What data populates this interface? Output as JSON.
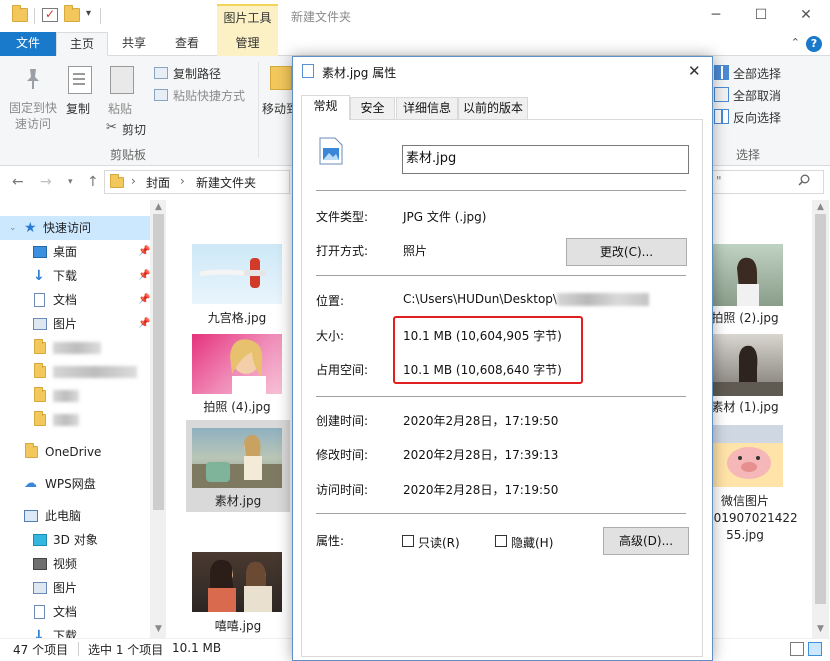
{
  "window": {
    "title": "新建文件夹",
    "context_tab_group": "图片工具"
  },
  "ribbon": {
    "tabs": [
      "文件",
      "主页",
      "共享",
      "查看",
      "管理"
    ],
    "pin_quick_access": [
      "固定到快",
      "速访问"
    ],
    "copy": "复制",
    "paste": "粘贴",
    "copy_path": "复制路径",
    "paste_shortcut": "粘贴快捷方式",
    "cut": "剪切",
    "clipboard_group": "剪贴板",
    "move_to": "移动到",
    "select_all": "全部选择",
    "select_none": "全部取消",
    "invert_selection": "反向选择",
    "select_group": "选择"
  },
  "address": {
    "crumbs": [
      "封面",
      "新建文件夹"
    ],
    "search_fragment": "\""
  },
  "nav": {
    "quick_access": "快速访问",
    "desktop": "桌面",
    "downloads": "下载",
    "documents": "文档",
    "pictures": "图片",
    "onedrive": "OneDrive",
    "wps": "WPS网盘",
    "this_pc": "此电脑",
    "objects3d": "3D 对象",
    "videos": "视频",
    "pictures2": "图片",
    "documents2": "文档",
    "downloads2": "下载"
  },
  "files": {
    "f1": "九宫格.jpg",
    "f2": "拍照 (4).jpg",
    "f3": "素材.jpg",
    "f4": "嘻嘻.jpg",
    "r1": "拍照 (2).jpg",
    "r2": "素材 (1).jpg",
    "r3": [
      "微信图片",
      "_201907021422",
      "55.jpg"
    ]
  },
  "status": {
    "count": "47 个项目",
    "selected": "选中 1 个项目",
    "size": "10.1 MB"
  },
  "dialog": {
    "title": "素材.jpg 属性",
    "tabs": [
      "常规",
      "安全",
      "详细信息",
      "以前的版本"
    ],
    "filename": "素材.jpg",
    "type_label": "文件类型:",
    "type_value": "JPG 文件 (.jpg)",
    "open_with_label": "打开方式:",
    "open_with_value": "照片",
    "change_button": "更改(C)...",
    "location_label": "位置:",
    "location_value": "C:\\Users\\HUDun\\Desktop\\",
    "size_label": "大小:",
    "size_value": "10.1 MB (10,604,905 字节)",
    "disk_label": "占用空间:",
    "disk_value": "10.1 MB (10,608,640 字节)",
    "created_label": "创建时间:",
    "created_value": "2020年2月28日，17:19:50",
    "modified_label": "修改时间:",
    "modified_value": "2020年2月28日，17:39:13",
    "accessed_label": "访问时间:",
    "accessed_value": "2020年2月28日，17:19:50",
    "attr_label": "属性:",
    "readonly": "只读(R)",
    "hidden": "隐藏(H)",
    "advanced_button": "高级(D)..."
  },
  "colors": {
    "accent": "#1979ca",
    "context_tab": "#fbf1c4",
    "highlight_box": "#e02020",
    "selection": "#cce8ff"
  }
}
